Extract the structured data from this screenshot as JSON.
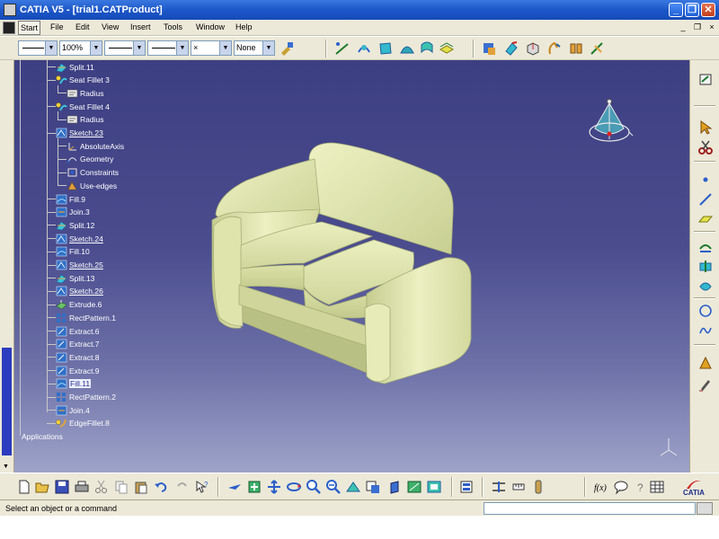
{
  "window": {
    "title": "CATIA V5 - [trial1.CATProduct]",
    "minimize_label": "_",
    "restore_label": "❐",
    "close_label": "✕"
  },
  "menu": {
    "items": [
      "Start",
      "File",
      "Edit",
      "View",
      "Insert",
      "Tools",
      "Window",
      "Help"
    ],
    "mdi_minimize": "_",
    "mdi_restore": "❐",
    "mdi_close": "×"
  },
  "properties_toolbar": {
    "zoom_value": "100%",
    "point_value": "×",
    "layer_value": "None"
  },
  "tree": {
    "nodes": [
      {
        "label": "Split.11",
        "icon": "split-icon",
        "style": "normal"
      },
      {
        "label": "Seat Fillet 3",
        "icon": "fillet-icon",
        "style": "normal"
      },
      {
        "label": "Radius",
        "icon": "parameter-icon",
        "style": "normal"
      },
      {
        "label": "Seat Fillet 4",
        "icon": "fillet-icon",
        "style": "normal"
      },
      {
        "label": "Radius",
        "icon": "parameter-icon",
        "style": "normal"
      },
      {
        "label": "Sketch.23",
        "icon": "sketch-icon",
        "style": "sketch"
      },
      {
        "label": "AbsoluteAxis",
        "icon": "axis-icon",
        "style": "normal"
      },
      {
        "label": "Geometry",
        "icon": "geometry-icon",
        "style": "normal"
      },
      {
        "label": "Constraints",
        "icon": "constraints-icon",
        "style": "normal"
      },
      {
        "label": "Use-edges",
        "icon": "use-edges-icon",
        "style": "normal"
      },
      {
        "label": "Fill.9",
        "icon": "fill-icon",
        "style": "normal"
      },
      {
        "label": "Join.3",
        "icon": "join-icon",
        "style": "normal"
      },
      {
        "label": "Split.12",
        "icon": "split-icon",
        "style": "normal"
      },
      {
        "label": "Sketch.24",
        "icon": "sketch-icon",
        "style": "sketch"
      },
      {
        "label": "Fill.10",
        "icon": "fill-icon",
        "style": "normal"
      },
      {
        "label": "Sketch.25",
        "icon": "sketch-icon",
        "style": "sketch"
      },
      {
        "label": "Split.13",
        "icon": "split-icon",
        "style": "normal"
      },
      {
        "label": "Sketch.26",
        "icon": "sketch-icon",
        "style": "sketch"
      },
      {
        "label": "Extrude.6",
        "icon": "extrude-icon",
        "style": "normal"
      },
      {
        "label": "RectPattern.1",
        "icon": "pattern-icon",
        "style": "normal"
      },
      {
        "label": "Extract.6",
        "icon": "extract-icon",
        "style": "normal"
      },
      {
        "label": "Extract.7",
        "icon": "extract-icon",
        "style": "normal"
      },
      {
        "label": "Extract.8",
        "icon": "extract-icon",
        "style": "normal"
      },
      {
        "label": "Extract.9",
        "icon": "extract-icon",
        "style": "normal"
      },
      {
        "label": "Fill.11",
        "icon": "fill-icon",
        "style": "boxed"
      },
      {
        "label": "RectPattern.2",
        "icon": "pattern-icon",
        "style": "normal"
      },
      {
        "label": "Join.4",
        "icon": "join-icon",
        "style": "normal"
      },
      {
        "label": "EdgeFillet.8",
        "icon": "edge-fillet-icon",
        "style": "normal"
      }
    ],
    "applications_label": "Applications"
  },
  "status": {
    "message": "Select an object or a command"
  },
  "brand": {
    "logo_text": "CATIA"
  },
  "colors": {
    "viewport_top": "#3d3f83",
    "viewport_bottom": "#9ea3c9",
    "sofa_body": "#e2e8b2",
    "title_bar": "#1d57c9"
  }
}
